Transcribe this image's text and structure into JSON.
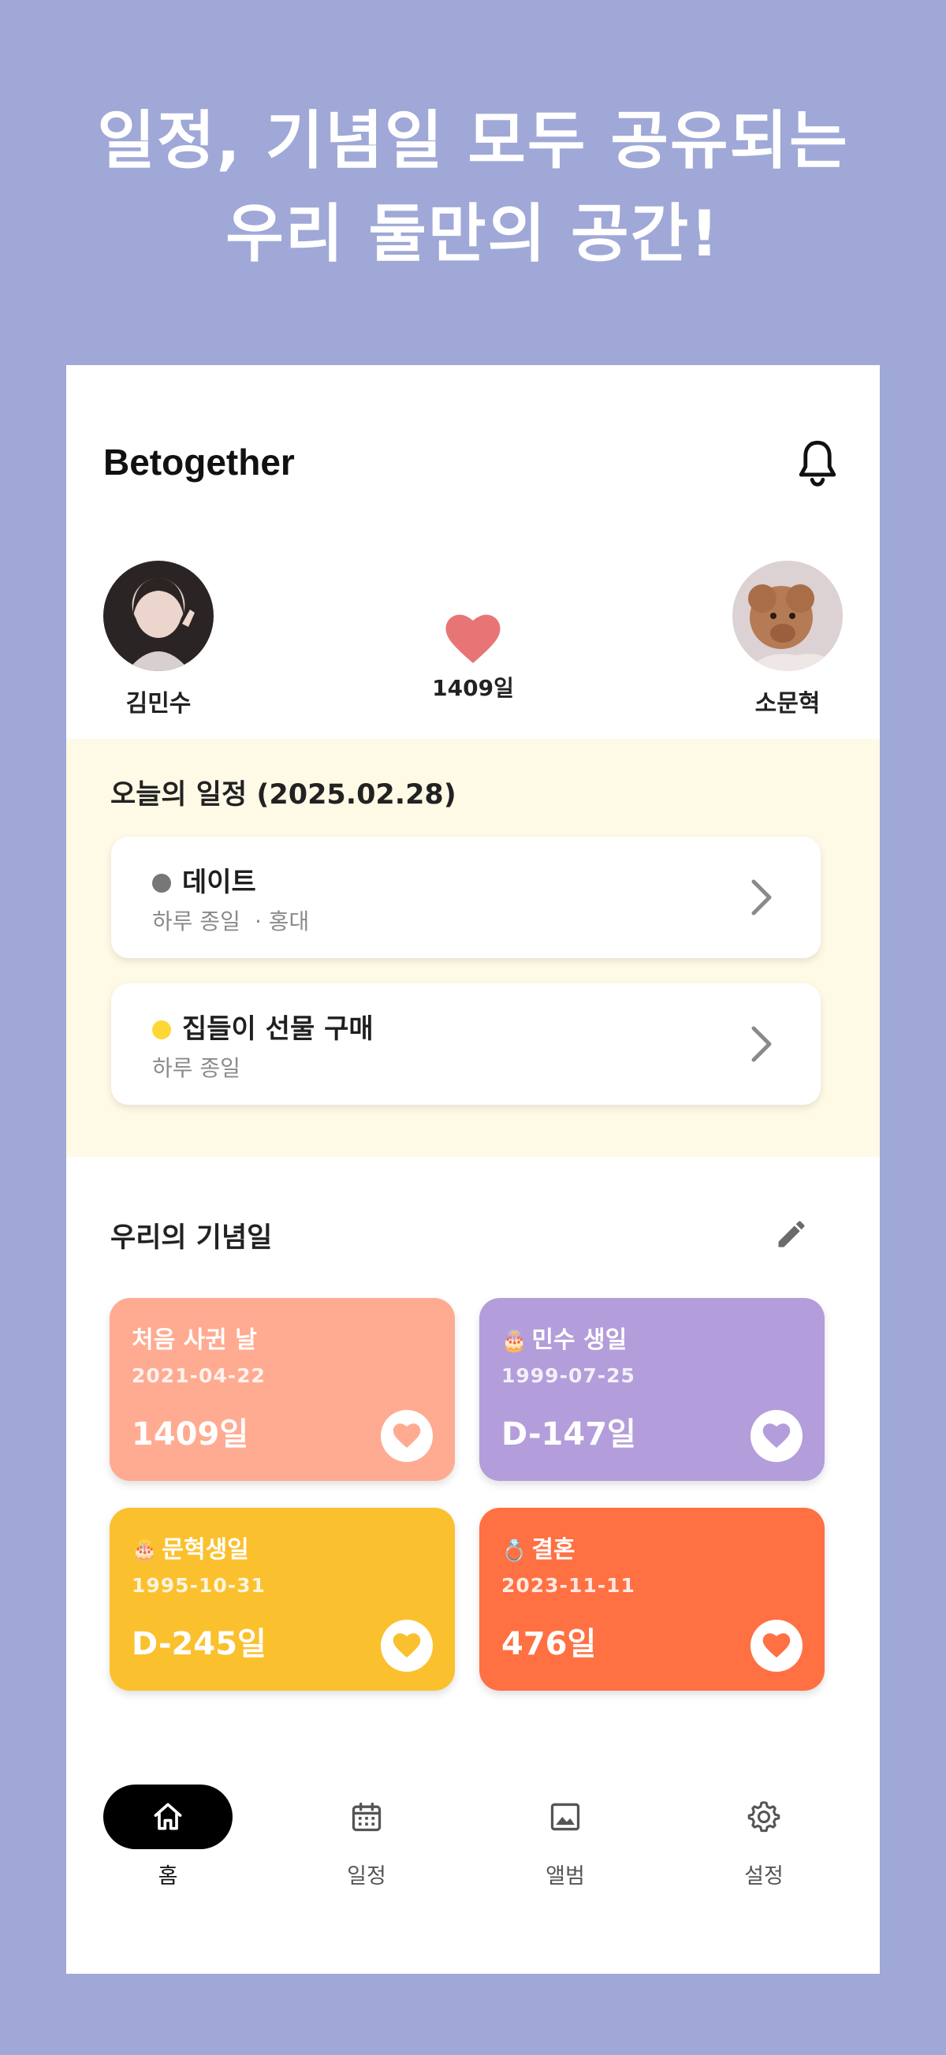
{
  "promo": {
    "line1": "일정, 기념일 모두 공유되는",
    "line2": "우리 둘만의 공간!"
  },
  "header": {
    "app_title": "Betogether",
    "bell_icon": "bell-icon"
  },
  "couple": {
    "left_name": "김민수",
    "right_name": "소문혁",
    "together_days": "1409일",
    "heart_color": "#e87575"
  },
  "today": {
    "title": "오늘의 일정 (2025.02.28)",
    "items": [
      {
        "title": "데이트",
        "time": "하루 종일",
        "location": "· 홍대",
        "dot_color": "#777777"
      },
      {
        "title": "집들이 선물 구매",
        "time": "하루 종일",
        "location": "",
        "dot_color": "#fdd835"
      }
    ]
  },
  "anniversaries": {
    "title": "우리의 기념일",
    "edit_icon": "pencil-icon",
    "items": [
      {
        "emoji": "",
        "name": "처음 사귄 날",
        "date": "2021-04-22",
        "count": "1409일",
        "color": "#ffab91"
      },
      {
        "emoji": "🎂",
        "name": "민수 생일",
        "date": "1999-07-25",
        "count": "D-147일",
        "color": "#b39ddb"
      },
      {
        "emoji": "🎂",
        "name": "문혁생일",
        "date": "1995-10-31",
        "count": "D-245일",
        "color": "#fbc02d"
      },
      {
        "emoji": "💍",
        "name": "결혼",
        "date": "2023-11-11",
        "count": "476일",
        "color": "#ff7043"
      }
    ]
  },
  "tabs": [
    {
      "label": "홈",
      "icon": "home-icon",
      "active": true
    },
    {
      "label": "일정",
      "icon": "calendar-icon",
      "active": false
    },
    {
      "label": "앨범",
      "icon": "image-icon",
      "active": false
    },
    {
      "label": "설정",
      "icon": "gear-icon",
      "active": false
    }
  ]
}
